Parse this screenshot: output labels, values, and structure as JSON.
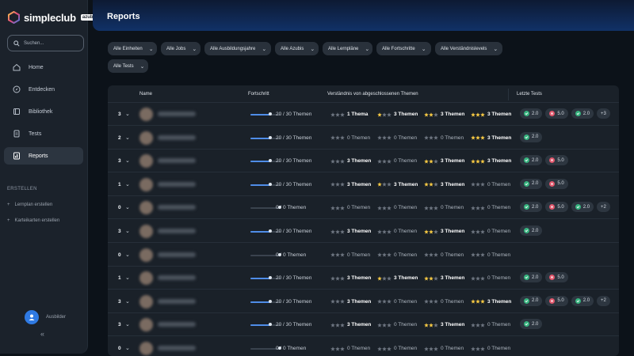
{
  "app": {
    "name": "simpleclub",
    "badge": "azubi"
  },
  "search": {
    "placeholder": "Suchen..."
  },
  "nav": [
    {
      "label": "Home",
      "icon": "home-icon",
      "active": false
    },
    {
      "label": "Entdecken",
      "icon": "compass-icon",
      "active": false
    },
    {
      "label": "Bibliothek",
      "icon": "library-icon",
      "active": false
    },
    {
      "label": "Tests",
      "icon": "tests-icon",
      "active": false
    },
    {
      "label": "Reports",
      "icon": "reports-icon",
      "active": true
    }
  ],
  "create": {
    "title": "ERSTELLEN",
    "items": [
      "Lernplan erstellen",
      "Karteikarten erstellen"
    ]
  },
  "user": {
    "label": "Ausbilder"
  },
  "page": {
    "title": "Reports"
  },
  "filters": [
    "Alle Einheiten",
    "Alle Jobs",
    "Alle Ausbildungsjahre",
    "Alle Azubis",
    "Alle Lernpläne",
    "Alle Fortschritte",
    "Alle Verständnislevels",
    "Alle Tests"
  ],
  "table": {
    "headers": {
      "name": "Name",
      "progress": "Fortschritt",
      "understanding": "Verständnis von abgeschlossenen Themen",
      "tests": "Letzte Tests"
    },
    "rows": [
      {
        "count": "3",
        "progress": "20 / 30 Themen",
        "progress_fraction": 0.67,
        "levels": [
          "1 Thema",
          "3 Themen",
          "3 Themen",
          "3 Themen"
        ],
        "tests": [
          {
            "ok": true,
            "score": "2.0"
          },
          {
            "ok": false,
            "score": "5.0"
          },
          {
            "ok": true,
            "score": "2.0"
          }
        ],
        "more": "+3"
      },
      {
        "count": "2",
        "progress": "20 / 30 Themen",
        "progress_fraction": 0.67,
        "levels": [
          "0 Themen",
          "0 Themen",
          "0 Themen",
          "3 Themen"
        ],
        "tests": [
          {
            "ok": true,
            "score": "2.0"
          }
        ],
        "more": ""
      },
      {
        "count": "3",
        "progress": "20 / 30 Themen",
        "progress_fraction": 0.67,
        "levels": [
          "3 Themen",
          "0 Themen",
          "3 Themen",
          "3 Themen"
        ],
        "tests": [
          {
            "ok": true,
            "score": "2.0"
          },
          {
            "ok": false,
            "score": "5.0"
          }
        ],
        "more": ""
      },
      {
        "count": "1",
        "progress": "20 / 30 Themen",
        "progress_fraction": 0.67,
        "levels": [
          "3 Themen",
          "3 Themen",
          "3 Themen",
          "0 Themen"
        ],
        "tests": [
          {
            "ok": true,
            "score": "2.0"
          },
          {
            "ok": false,
            "score": "5.0"
          }
        ],
        "more": ""
      },
      {
        "count": "0",
        "progress": "0 / 0 Themen",
        "progress_fraction": 0,
        "levels": [
          "0 Themen",
          "0 Themen",
          "0 Themen",
          "0 Themen"
        ],
        "tests": [
          {
            "ok": true,
            "score": "2.0"
          },
          {
            "ok": false,
            "score": "5.0"
          },
          {
            "ok": true,
            "score": "2.0"
          }
        ],
        "more": "+2"
      },
      {
        "count": "3",
        "progress": "20 / 30 Themen",
        "progress_fraction": 0.67,
        "levels": [
          "3 Themen",
          "0 Themen",
          "3 Themen",
          "0 Themen"
        ],
        "tests": [
          {
            "ok": true,
            "score": "2.0"
          }
        ],
        "more": ""
      },
      {
        "count": "0",
        "progress": "0 / 0 Themen",
        "progress_fraction": 0,
        "levels": [
          "0 Themen",
          "0 Themen",
          "0 Themen",
          "0 Themen"
        ],
        "tests": [],
        "more": ""
      },
      {
        "count": "1",
        "progress": "20 / 30 Themen",
        "progress_fraction": 0.67,
        "levels": [
          "3 Themen",
          "3 Themen",
          "3 Themen",
          "0 Themen"
        ],
        "tests": [
          {
            "ok": true,
            "score": "2.0"
          },
          {
            "ok": false,
            "score": "5.0"
          }
        ],
        "more": ""
      },
      {
        "count": "3",
        "progress": "20 / 30 Themen",
        "progress_fraction": 0.67,
        "levels": [
          "3 Themen",
          "0 Themen",
          "0 Themen",
          "3 Themen"
        ],
        "tests": [
          {
            "ok": true,
            "score": "2.0"
          },
          {
            "ok": false,
            "score": "5.0"
          },
          {
            "ok": true,
            "score": "2.0"
          }
        ],
        "more": "+2"
      },
      {
        "count": "3",
        "progress": "20 / 30 Themen",
        "progress_fraction": 0.67,
        "levels": [
          "3 Themen",
          "0 Themen",
          "3 Themen",
          "0 Themen"
        ],
        "tests": [
          {
            "ok": true,
            "score": "2.0"
          }
        ],
        "more": ""
      },
      {
        "count": "0",
        "progress": "0 / 0 Themen",
        "progress_fraction": 0,
        "levels": [
          "0 Themen",
          "0 Themen",
          "0 Themen",
          "0 Themen"
        ],
        "tests": [],
        "more": ""
      }
    ]
  },
  "colors": {
    "accent": "#4f8de8",
    "star": "#f5c843",
    "success": "#36b37e",
    "error": "#e0566b",
    "header": "#113167"
  }
}
